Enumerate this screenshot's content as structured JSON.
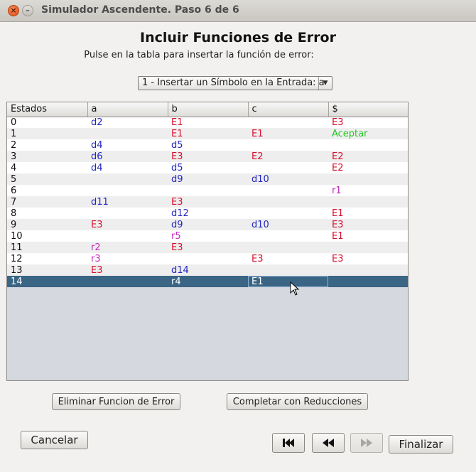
{
  "window": {
    "title": "Simulador Ascendente. Paso 6 de 6",
    "close_glyph": "×",
    "minimize_glyph": "–"
  },
  "heading": "Incluir Funciones de Error",
  "instruction": "Pulse en la tabla para insertar la función de error:",
  "combo": {
    "selected": "1 - Insertar un Símbolo en la Entrada: a",
    "arrow_glyph": "▼"
  },
  "table": {
    "columns": [
      "Estados",
      "a",
      "b",
      "c",
      "$"
    ],
    "rows": [
      {
        "state": "0",
        "cells": [
          {
            "v": "d2",
            "k": "d"
          },
          {
            "v": "E1",
            "k": "e"
          },
          {
            "v": "",
            "k": ""
          },
          {
            "v": "E3",
            "k": "e"
          }
        ]
      },
      {
        "state": "1",
        "cells": [
          {
            "v": "",
            "k": ""
          },
          {
            "v": "E1",
            "k": "e"
          },
          {
            "v": "E1",
            "k": "e"
          },
          {
            "v": "Aceptar",
            "k": "ok"
          }
        ]
      },
      {
        "state": "2",
        "cells": [
          {
            "v": "d4",
            "k": "d"
          },
          {
            "v": "d5",
            "k": "d"
          },
          {
            "v": "",
            "k": ""
          },
          {
            "v": "",
            "k": ""
          }
        ]
      },
      {
        "state": "3",
        "cells": [
          {
            "v": "d6",
            "k": "d"
          },
          {
            "v": "E3",
            "k": "e"
          },
          {
            "v": "E2",
            "k": "e"
          },
          {
            "v": "E2",
            "k": "e"
          }
        ]
      },
      {
        "state": "4",
        "cells": [
          {
            "v": "d4",
            "k": "d"
          },
          {
            "v": "d5",
            "k": "d"
          },
          {
            "v": "",
            "k": ""
          },
          {
            "v": "E2",
            "k": "e"
          }
        ]
      },
      {
        "state": "5",
        "cells": [
          {
            "v": "",
            "k": ""
          },
          {
            "v": "d9",
            "k": "d"
          },
          {
            "v": "d10",
            "k": "d"
          },
          {
            "v": "",
            "k": ""
          }
        ]
      },
      {
        "state": "6",
        "cells": [
          {
            "v": "",
            "k": ""
          },
          {
            "v": "",
            "k": ""
          },
          {
            "v": "",
            "k": ""
          },
          {
            "v": "r1",
            "k": "r"
          }
        ]
      },
      {
        "state": "7",
        "cells": [
          {
            "v": "d11",
            "k": "d"
          },
          {
            "v": "E3",
            "k": "e"
          },
          {
            "v": "",
            "k": ""
          },
          {
            "v": "",
            "k": ""
          }
        ]
      },
      {
        "state": "8",
        "cells": [
          {
            "v": "",
            "k": ""
          },
          {
            "v": "d12",
            "k": "d"
          },
          {
            "v": "",
            "k": ""
          },
          {
            "v": "E1",
            "k": "e"
          }
        ]
      },
      {
        "state": "9",
        "cells": [
          {
            "v": "E3",
            "k": "e"
          },
          {
            "v": "d9",
            "k": "d"
          },
          {
            "v": "d10",
            "k": "d"
          },
          {
            "v": "E3",
            "k": "e"
          }
        ]
      },
      {
        "state": "10",
        "cells": [
          {
            "v": "",
            "k": ""
          },
          {
            "v": "r5",
            "k": "r"
          },
          {
            "v": "",
            "k": ""
          },
          {
            "v": "E1",
            "k": "e"
          }
        ]
      },
      {
        "state": "11",
        "cells": [
          {
            "v": "r2",
            "k": "r"
          },
          {
            "v": "E3",
            "k": "e"
          },
          {
            "v": "",
            "k": ""
          },
          {
            "v": "",
            "k": ""
          }
        ]
      },
      {
        "state": "12",
        "cells": [
          {
            "v": "r3",
            "k": "r"
          },
          {
            "v": "",
            "k": ""
          },
          {
            "v": "E3",
            "k": "e"
          },
          {
            "v": "E3",
            "k": "e"
          }
        ]
      },
      {
        "state": "13",
        "cells": [
          {
            "v": "E3",
            "k": "e"
          },
          {
            "v": "d14",
            "k": "d"
          },
          {
            "v": "",
            "k": ""
          },
          {
            "v": "",
            "k": ""
          }
        ]
      },
      {
        "state": "14",
        "cells": [
          {
            "v": "",
            "k": ""
          },
          {
            "v": "r4",
            "k": "r"
          },
          {
            "v": "E1",
            "k": "e"
          },
          {
            "v": "",
            "k": ""
          }
        ]
      }
    ],
    "selected_row": 14,
    "focused_column": 3
  },
  "buttons": {
    "remove_error": "Eliminar Funcion de Error",
    "complete_reductions": "Completar con Reducciones",
    "cancel": "Cancelar",
    "finish": "Finalizar"
  },
  "nav": {
    "first_icon": "skip-to-first-icon",
    "back_icon": "rewind-icon",
    "forward_icon": "fast-forward-icon",
    "forward_enabled": false
  },
  "colors": {
    "shift": "#2226c0",
    "error": "#d8102f",
    "reduce": "#c428c0",
    "accept": "#1fc91f",
    "selection": "#3a6585"
  }
}
